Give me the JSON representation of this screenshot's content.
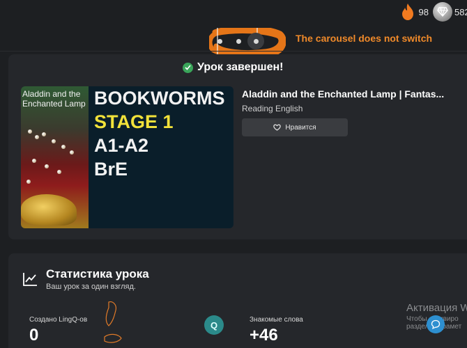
{
  "top_stats": {
    "streak_value": "98",
    "gems_value": "582",
    "icons": [
      "flame-icon",
      "gem-icon"
    ]
  },
  "carousel": {
    "dot_count": 3,
    "active_index": 2
  },
  "annotation": {
    "text": "The carousel does not switch",
    "color": "#f08a2a"
  },
  "lesson": {
    "status": "Урок завершен!",
    "cover": {
      "side_title": "Aladdin and the Enchanted Lamp",
      "lines": [
        "BOOKWORMS",
        "STAGE 1",
        "A1-A2",
        "BrE"
      ]
    },
    "title": "Aladdin and the Enchanted Lamp | Fantas...",
    "subtitle": "Reading English",
    "like_label": "Нравится"
  },
  "stats": {
    "title": "Статистика урока",
    "subtitle": "Ваш урок за один взгляд.",
    "metrics": [
      {
        "label": "Создано LingQ-ов",
        "value": "0"
      },
      {
        "label": "Знакомые слова",
        "value": "+46"
      }
    ],
    "q_badge": "Q"
  },
  "watermark": {
    "line1": "Активация W",
    "line2": "Чтобы активиро",
    "line3": "раздел \"Парамет"
  },
  "colors": {
    "background": "#1d1f22",
    "card": "#25272b",
    "success": "#3aa55a",
    "stage_yellow": "#f2e23a"
  }
}
